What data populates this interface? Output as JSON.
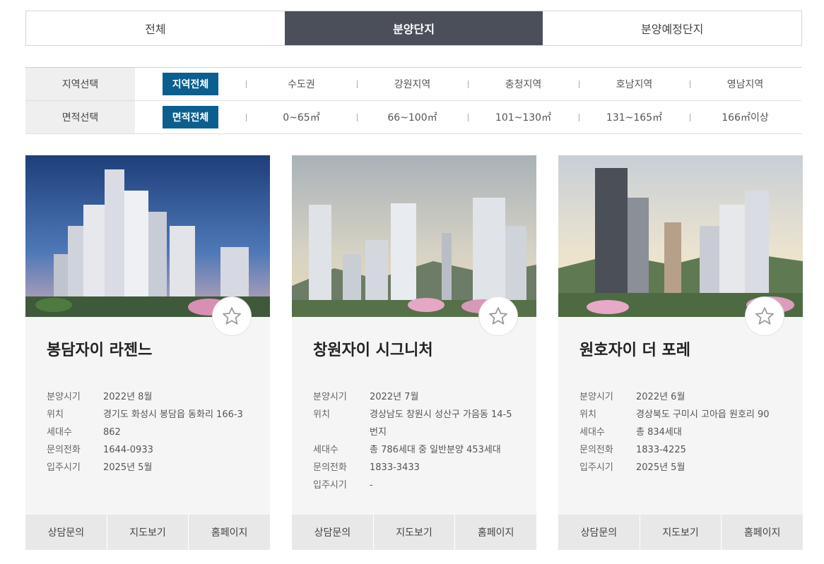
{
  "tabs": {
    "all": "전체",
    "selling": "분양단지",
    "upcoming": "분양예정단지"
  },
  "filters": {
    "region": {
      "label": "지역선택",
      "options": [
        "지역전체",
        "수도권",
        "강원지역",
        "충청지역",
        "호남지역",
        "영남지역"
      ]
    },
    "area": {
      "label": "면적선택",
      "options": [
        "면적전체",
        "0~65㎡",
        "66~100㎡",
        "101~130㎡",
        "131~165㎡",
        "166㎡이상"
      ]
    }
  },
  "info_labels": {
    "sale": "분양시기",
    "location": "위치",
    "households": "세대수",
    "phone": "문의전화",
    "movein": "입주시기"
  },
  "actions": {
    "consult": "상담문의",
    "map": "지도보기",
    "home": "홈페이지"
  },
  "cards": [
    {
      "title": "봉담자이 라젠느",
      "sale": "2022년 8월",
      "location": "경기도 화성시 봉담읍 동화리 166-3",
      "households": "862",
      "phone": "1644-0933",
      "movein": "2025년 5월"
    },
    {
      "title": "창원자이 시그니처",
      "sale": "2022년 7월",
      "location": "경상남도 창원시 성산구 가음동 14-5번지",
      "households": "총 786세대 중 일반분양 453세대",
      "phone": "1833-3433",
      "movein": "-"
    },
    {
      "title": "원호자이 더 포레",
      "sale": "2022년 6월",
      "location": "경상북도 구미시 고아읍 원호리 90",
      "households": "총 834세대",
      "phone": "1833-4225",
      "movein": "2025년 5월"
    }
  ],
  "colors": {
    "tab_active": "#4a4f5a",
    "filter_selected": "#0a5f8e"
  }
}
